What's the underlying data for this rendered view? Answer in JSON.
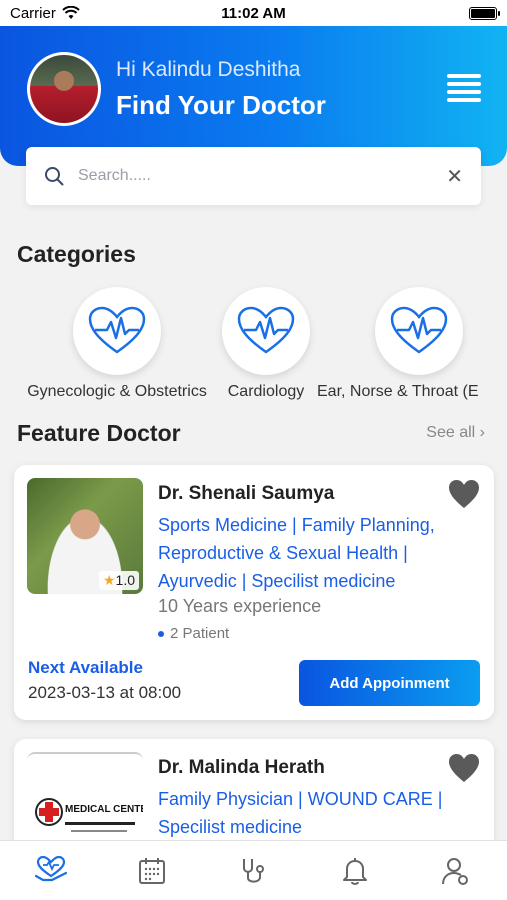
{
  "status_bar": {
    "carrier": "Carrier",
    "time": "11:02 AM"
  },
  "header": {
    "greeting": "Hi Kalindu Deshitha",
    "headline": "Find Your Doctor"
  },
  "search": {
    "placeholder": "Search....."
  },
  "categories_section": {
    "title": "Categories",
    "items": [
      {
        "label": "Gynecologic & Obstetrics"
      },
      {
        "label": "Cardiology"
      },
      {
        "label": "Ear, Norse & Throat (E"
      }
    ]
  },
  "feature_section": {
    "title": "Feature Doctor",
    "see_all": "See all"
  },
  "doctors": [
    {
      "name": "Dr. Shenali Saumya",
      "rating": "1.0",
      "specialties": "Sports Medicine | Family Planning, Reproductive & Sexual Health | Ayurvedic | Specilist medicine",
      "experience": "10 Years experience",
      "patients": "2 Patient",
      "next_label": "Next Available",
      "next_date": "2023-03-13 at 08:00",
      "button": "Add Appoinment"
    },
    {
      "name": "Dr. Malinda Herath",
      "specialties": "Family Physician | WOUND CARE | Specilist medicine",
      "logo_text": "MEDICAL CENTER"
    }
  ],
  "colors": {
    "primary": "#0a55e0",
    "accent": "#11b3f2",
    "link": "#1a5ee6"
  },
  "tabs": [
    {
      "icon": "heart-hand-icon"
    },
    {
      "icon": "calendar-icon"
    },
    {
      "icon": "stethoscope-icon"
    },
    {
      "icon": "bell-icon"
    },
    {
      "icon": "profile-icon"
    }
  ]
}
